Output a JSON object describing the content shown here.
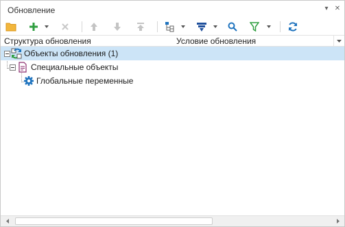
{
  "panel": {
    "title": "Обновление"
  },
  "toolbar": {
    "buttons": [
      {
        "icon": "open-folder-icon"
      },
      {
        "icon": "add-icon",
        "dropdown": true
      },
      {
        "icon": "delete-icon"
      },
      {
        "icon": "move-up-icon"
      },
      {
        "icon": "move-down-icon"
      },
      {
        "icon": "move-top-icon"
      },
      {
        "icon": "tree-structure-icon",
        "dropdown": true
      },
      {
        "icon": "sort-icon",
        "dropdown": true
      },
      {
        "icon": "search-icon"
      },
      {
        "icon": "filter-icon",
        "dropdown": true
      },
      {
        "icon": "refresh-icon"
      }
    ]
  },
  "columns": {
    "structure": "Структура обновления",
    "condition": "Условие обновления"
  },
  "tree": {
    "items": [
      {
        "label": "Объекты обновления (1)",
        "icon": "update-objects-icon",
        "selected": true,
        "expanded": true
      },
      {
        "label": "Специальные объекты",
        "icon": "document-icon",
        "expanded": true
      },
      {
        "label": "Глобальные переменные",
        "icon": "gear-icon"
      }
    ]
  },
  "colors": {
    "selection": "#cce4f7",
    "accent_blue": "#1e73be",
    "add_green": "#2e9e3f",
    "folder_yellow": "#f2b63c"
  }
}
